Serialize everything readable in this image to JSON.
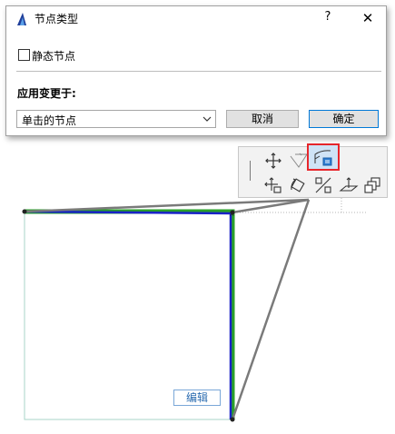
{
  "dialog": {
    "title": "节点类型",
    "help_label": "?",
    "close_label": "✕",
    "static_node_label": "静态节点",
    "static_node_checked": false,
    "apply_label": "应用变更于:",
    "apply_select_value": "单击的节点",
    "cancel_label": "取消",
    "ok_label": "确定"
  },
  "toolbar": {
    "tools_row1": [
      "move-icon",
      "offset-icon",
      "node-type-icon"
    ],
    "tools_row2": [
      "move-copy-icon",
      "rotate-icon",
      "mirror-icon",
      "elevate-icon",
      "duplicate-icon"
    ],
    "highlighted_tool": "node-type-icon",
    "highlight_color": "#e8262b"
  },
  "canvas": {
    "edit_label": "编辑",
    "colors": {
      "blue_edge": "#1a22c8",
      "green_edge": "#2aa02a",
      "outline": "#a8d5c8",
      "pointer_line": "#7a7a7a"
    }
  }
}
